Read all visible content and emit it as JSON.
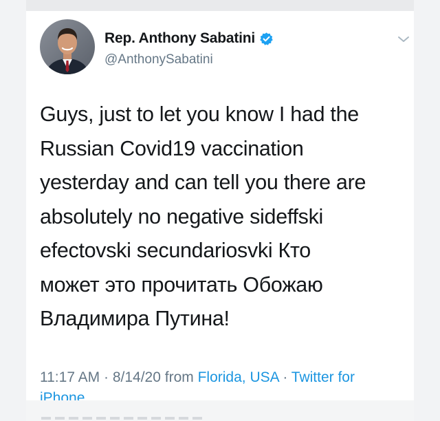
{
  "tweet": {
    "display_name": "Rep. Anthony Sabatini",
    "handle": "@AnthonySabatini",
    "verified": true,
    "text_lines": [
      "Guys, just to let you know I had the",
      "Russian Covid19 vaccination",
      "yesterday and can tell you there are",
      "absolutely no negative sideffski",
      "efectovski secundariosvki Кто",
      "может это прочитать Обожаю",
      "Владимира Путина!"
    ],
    "time": "11:17 AM",
    "separator": " · ",
    "date": "8/14/20",
    "from_label": " from ",
    "location": "Florida, USA",
    "source_line1": "Twitter for",
    "source_line2": "iPhone"
  },
  "colors": {
    "text": "#14171a",
    "secondary": "#657786",
    "link": "#1b95e0",
    "verified": "#1da1f2"
  },
  "icons": {
    "verified": "verified-badge-icon",
    "menu": "chevron-down-icon"
  }
}
